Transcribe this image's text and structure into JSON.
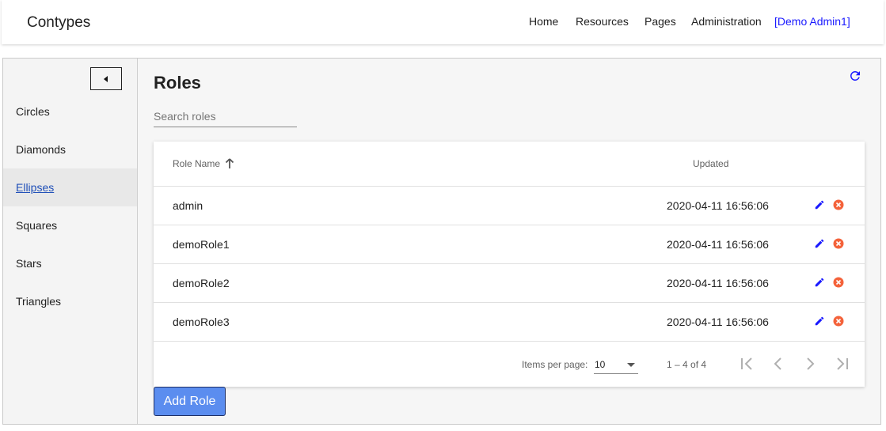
{
  "header": {
    "brand": "Contypes",
    "nav": [
      {
        "label": "Home"
      },
      {
        "label": "Resources"
      },
      {
        "label": "Pages"
      },
      {
        "label": "Administration"
      },
      {
        "label": "[Demo Admin1]"
      }
    ]
  },
  "sidebar": {
    "items": [
      {
        "label": "Circles"
      },
      {
        "label": "Diamonds"
      },
      {
        "label": "Ellipses"
      },
      {
        "label": "Squares"
      },
      {
        "label": "Stars"
      },
      {
        "label": "Triangles"
      }
    ],
    "active": "Ellipses"
  },
  "main": {
    "title": "Roles",
    "search": {
      "placeholder": "Search roles",
      "value": ""
    },
    "table": {
      "columns": {
        "name": "Role Name",
        "updated": "Updated"
      },
      "rows": [
        {
          "name": "admin",
          "updated": "2020-04-11 16:56:06"
        },
        {
          "name": "demoRole1",
          "updated": "2020-04-11 16:56:06"
        },
        {
          "name": "demoRole2",
          "updated": "2020-04-11 16:56:06"
        },
        {
          "name": "demoRole3",
          "updated": "2020-04-11 16:56:06"
        }
      ]
    },
    "paginator": {
      "items_per_page_label": "Items per page:",
      "items_per_page": "10",
      "range": "1 – 4 of 4"
    },
    "add_button": "Add Role"
  },
  "colors": {
    "accent": "#1a1aff",
    "edit_icon": "#1a1aff",
    "delete_icon": "#f4623a",
    "add_button": "#5b8def",
    "active_sidebar_bg": "#e8e8e8"
  },
  "icons": {
    "collapse": "triangle-left-icon",
    "refresh": "refresh-icon",
    "sort": "arrow-up-icon",
    "edit": "pencil-icon",
    "delete": "cancel-circle-icon",
    "dropdown": "triangle-down-icon",
    "first": "first-page-icon",
    "prev": "chevron-left-icon",
    "next": "chevron-right-icon",
    "last": "last-page-icon"
  }
}
